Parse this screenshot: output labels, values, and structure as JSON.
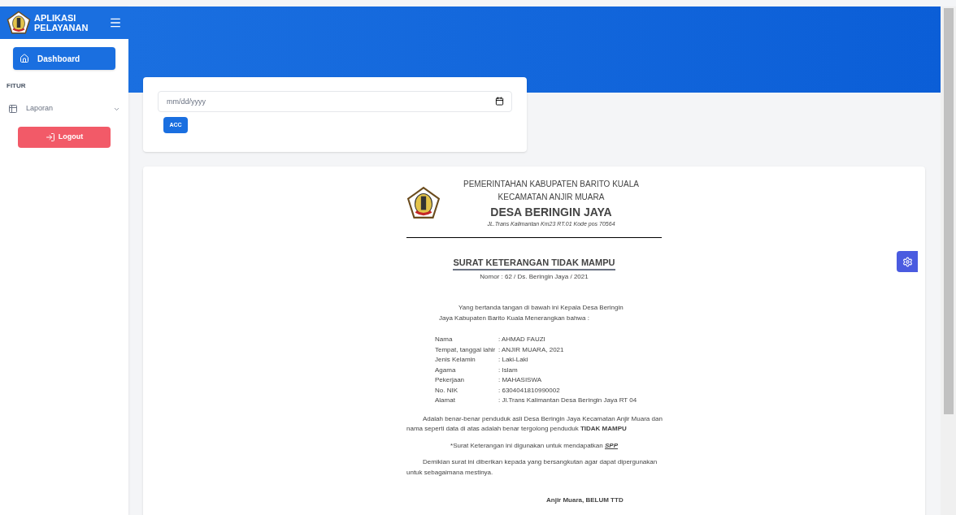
{
  "brand": {
    "line1": "APLIKASI",
    "line2": "PELAYANAN"
  },
  "sidebar": {
    "items": [
      {
        "kind": "link",
        "label": "Dashboard",
        "selected": true
      },
      {
        "kind": "heading",
        "label": "FITUR"
      },
      {
        "kind": "dropdown",
        "label": "Laporan",
        "selected": false
      },
      {
        "kind": "logout",
        "label": "Logout"
      }
    ]
  },
  "filter": {
    "date": {
      "placeholder": "mm/dd/yyyy"
    },
    "button": "ACC"
  },
  "letter": {
    "header": [
      "PEMERINTAHAN KABUPATEN BARITO KUALA",
      "KECAMATAN ANJIR MUARA"
    ],
    "village": "DESA BERINGIN JAYA",
    "address": "JL.Trans Kalimantan Km23 RT.01 Kode pos 70564",
    "title": "SURAT KETERANGAN TIDAK MAMPU",
    "number": "Nomor : 62 / Ds. Beringin Jaya / 2021",
    "intro": "Yang bertanda tangan di bawah ini Kepala Desa Beringin Jaya Kabupaten Barito Kuala Menerangkan bahwa :",
    "fields": [
      {
        "label": "Nama",
        "value": ": AHMAD FAUZI"
      },
      {
        "label": "Tempat, tanggal lahir",
        "value": ": ANJIR MUARA, 2021"
      },
      {
        "label": "Jenis Kelamin",
        "value": ": Laki-Laki"
      },
      {
        "label": "Agama",
        "value": ": Islam"
      },
      {
        "label": "Pekerjaan",
        "value": ": MAHASISWA"
      },
      {
        "label": "No. NIK",
        "value": ": 6304041810990002"
      },
      {
        "label": "Alamat",
        "value": ": Jl.Trans Kalimantan Desa Beringin Jaya RT 04"
      }
    ],
    "statement": "Adalah benar-benar penduduk asli Desa Beringin Jaya Kecamatan Anjir Muara dan nama seperti data di atas adalah benar tergolong penduduk **TIDAK MAMPU**",
    "purpose": {
      "text": "*Surat Keterangan ini digunakan untuk mendapatkan",
      "emphasis": "SPP"
    },
    "closing": "Demikian surat ini diberikan kepada yang bersangkutan agar dapat dipergunakan untuk sebagaimana mestinya.",
    "signature": "Anjir Muara, BELUM TTD"
  }
}
